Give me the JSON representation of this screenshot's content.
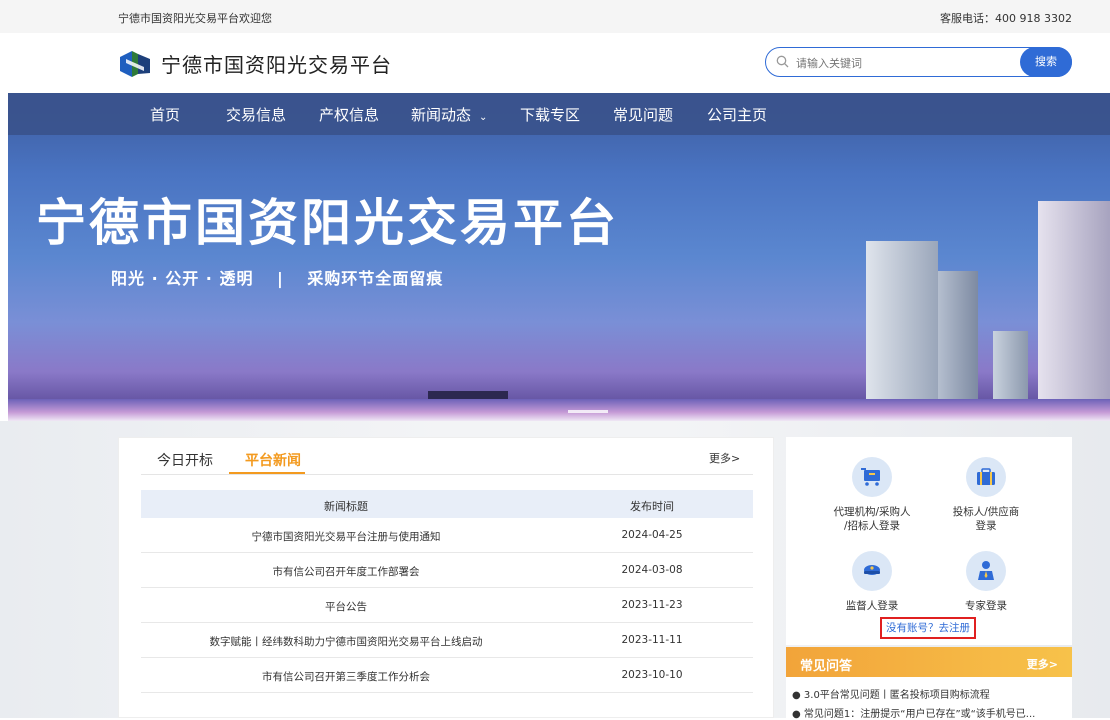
{
  "topbar": {
    "welcome": "宁德市国资阳光交易平台欢迎您",
    "phone": "客服电话：400 918 3302"
  },
  "header": {
    "site_name": "宁德市国资阳光交易平台",
    "search_placeholder": "请输入关键词",
    "search_button": "搜索"
  },
  "nav": {
    "items": [
      {
        "label": "首页"
      },
      {
        "label": "交易信息"
      },
      {
        "label": "产权信息"
      },
      {
        "label": "新闻动态"
      },
      {
        "label": "下载专区"
      },
      {
        "label": "常见问题"
      },
      {
        "label": "公司主页"
      }
    ]
  },
  "banner": {
    "title": "宁德市国资阳光交易平台",
    "subtitle": "阳光 · 公开 · 透明 　|　 采购环节全面留痕"
  },
  "news": {
    "tabs": [
      "今日开标",
      "平台新闻"
    ],
    "active_tab": "平台新闻",
    "more": "更多>",
    "columns": [
      "新闻标题",
      "发布时间"
    ],
    "rows": [
      {
        "title": "宁德市国资阳光交易平台注册与使用通知",
        "date": "2024-04-25"
      },
      {
        "title": "市有信公司召开年度工作部署会",
        "date": "2024-03-08"
      },
      {
        "title": "平台公告",
        "date": "2023-11-23"
      },
      {
        "title": "数字赋能丨经纬数科助力宁德市国资阳光交易平台上线启动",
        "date": "2023-11-11"
      },
      {
        "title": "市有信公司召开第三季度工作分析会",
        "date": "2023-10-10"
      }
    ]
  },
  "login": {
    "agency": "代理机构/采购人\n/招标人登录",
    "agency_l1": "代理机构/采购人",
    "agency_l2": "/招标人登录",
    "bidder_l1": "投标人/供应商",
    "bidder_l2": "登录",
    "supervisor": "监督人登录",
    "expert": "专家登录",
    "register": "没有账号？去注册"
  },
  "faq": {
    "title": "常见问答",
    "more": "更多>",
    "items": [
      "3.0平台常见问题丨匿名投标项目购标流程",
      "常见问题1：注册提示“用户已存在”或“该手机号已..."
    ]
  },
  "colors": {
    "accent": "#2f6bd6",
    "orange": "#f39a1f",
    "red": "#e02020"
  }
}
